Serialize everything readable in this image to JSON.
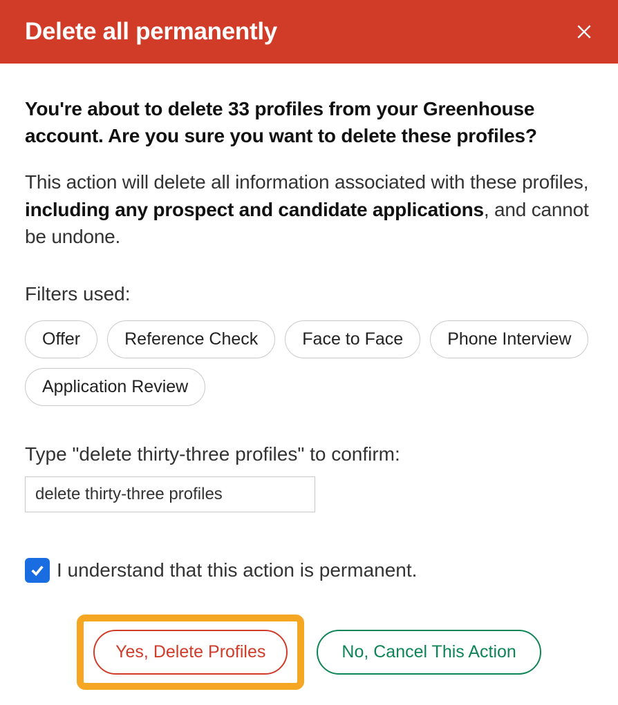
{
  "header": {
    "title": "Delete all permanently"
  },
  "body": {
    "confirm_heading": "You're about to delete 33 profiles from your Greenhouse account. Are you sure you want to delete these profiles?",
    "desc_part1": "This action will delete all information associated with these profiles, ",
    "desc_bold": "including any prospect and candidate applications",
    "desc_part2": ", and cannot be undone.",
    "filters_label": "Filters used:",
    "filters": [
      "Offer",
      "Reference Check",
      "Face to Face",
      "Phone Interview",
      "Application Review"
    ],
    "confirm_prompt": "Type \"delete thirty-three profiles\" to confirm:",
    "confirm_input_value": "delete thirty-three profiles",
    "ack_label": "I understand that this action is permanent.",
    "yes_button": "Yes, Delete Profiles",
    "no_button": "No, Cancel This Action"
  },
  "colors": {
    "header_bg": "#d13c29",
    "danger": "#d13c29",
    "safe": "#0f8557",
    "highlight": "#f5a623",
    "checkbox": "#1a6de0"
  }
}
